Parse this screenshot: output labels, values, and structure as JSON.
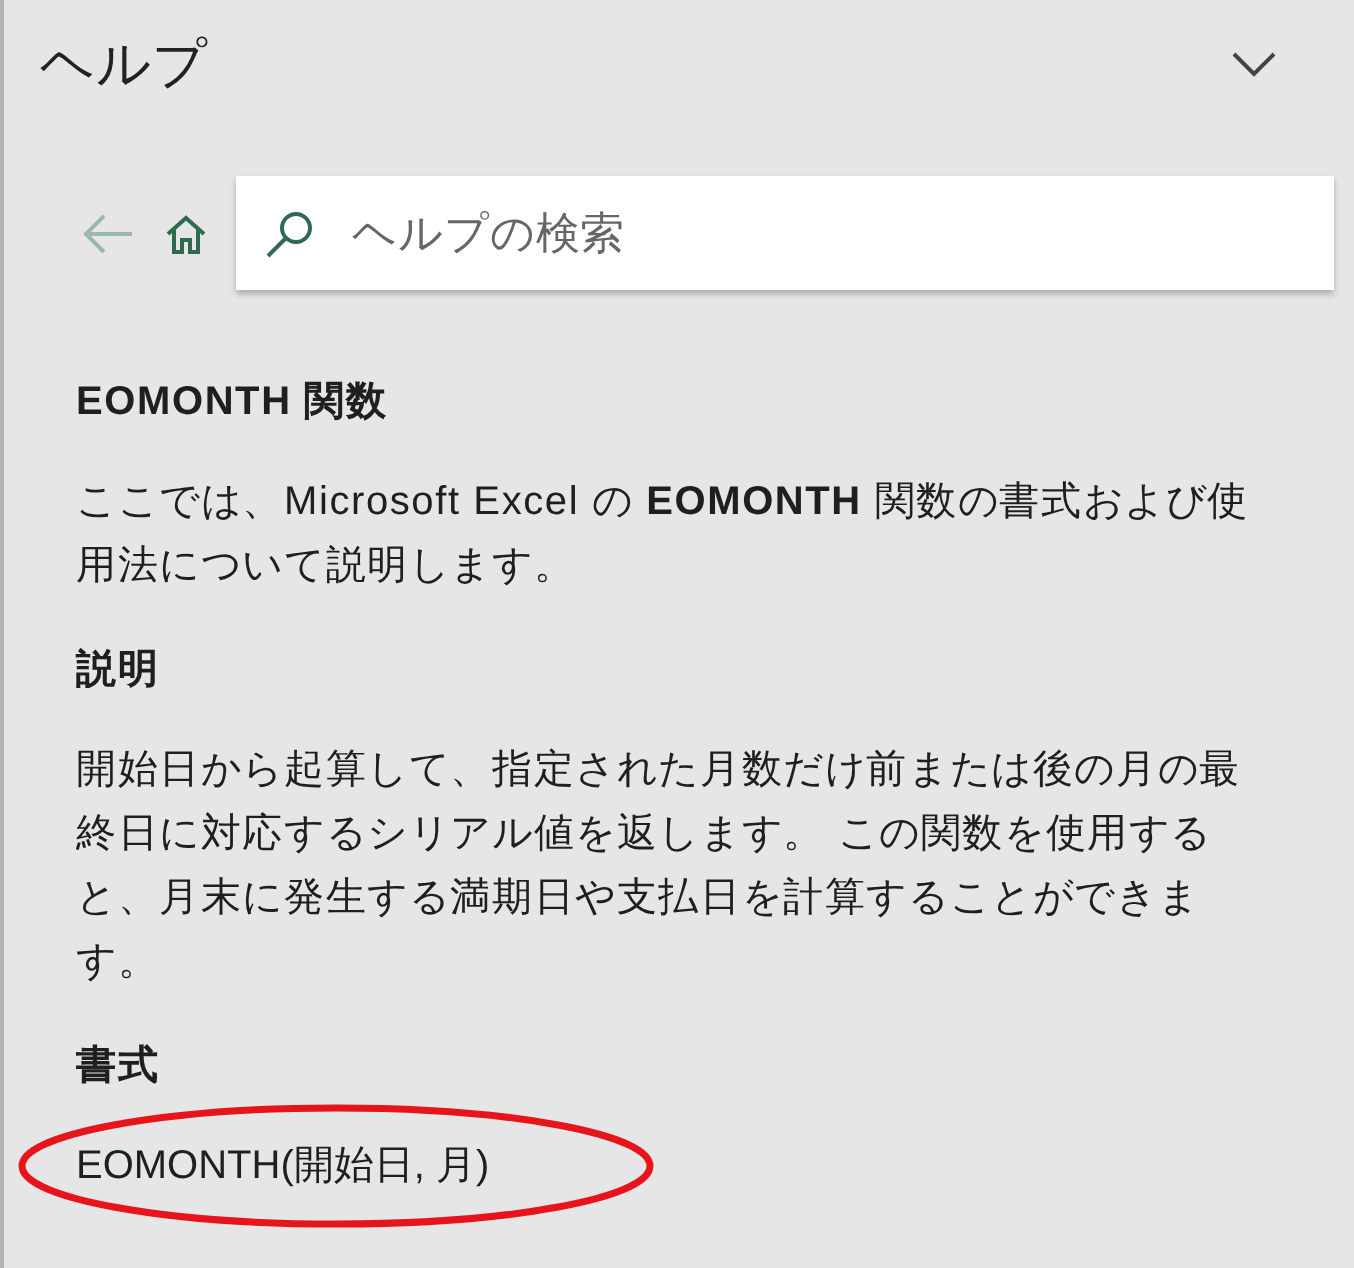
{
  "pane": {
    "title": "ヘルプ"
  },
  "search": {
    "placeholder": "ヘルプの検索"
  },
  "article": {
    "title": "EOMONTH 関数",
    "intro": "ここでは、Microsoft Excel の **EOMONTH** 関数の書式および使用法について説明します。",
    "sections": [
      {
        "heading": "説明",
        "body": "開始日から起算して、指定された月数だけ前または後の月の最終日に対応するシリアル値を返します。 この関数を使用すると、月末に発生する満期日や支払日を計算することができます。"
      },
      {
        "heading": "書式",
        "syntax": "EOMONTH(開始日, 月)",
        "circled": true
      }
    ]
  }
}
